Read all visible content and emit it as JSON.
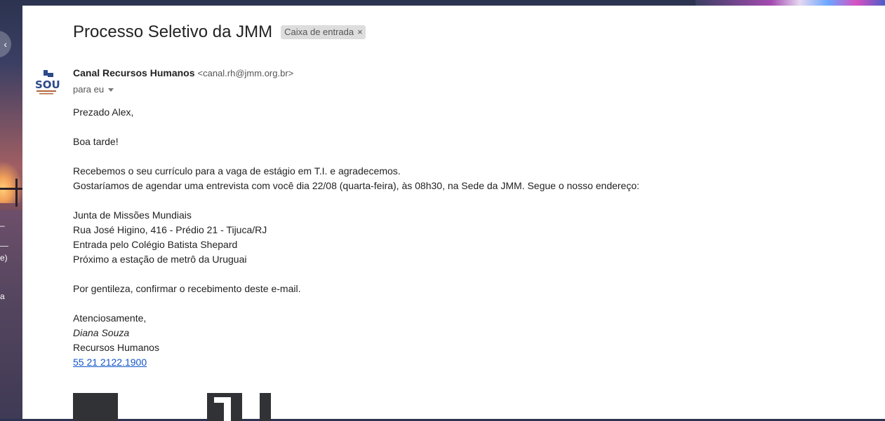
{
  "email": {
    "subject": "Processo Seletivo da JMM",
    "label": "Caixa de entrada",
    "label_close": "×",
    "sender_name": "Canal Recursos Humanos",
    "sender_email": "<canal.rh@jmm.org.br>",
    "to": "para eu",
    "avatar_icon": "sou-logo-icon",
    "body": {
      "greeting": "Prezado Alex,",
      "hello": "Boa tarde!",
      "line1": "Recebemos o seu currículo para a vaga de estágio em T.I. e agradecemos.",
      "line2": "Gostaríamos de agendar uma entrevista com você dia 22/08 (quarta-feira), às 08h30, na Sede da JMM. Segue o nosso endereço:",
      "address": [
        "Junta de Missões Mundiais",
        "Rua José Higino, 416 - Prédio 21 - Tijuca/RJ",
        "Entrada pelo Colégio Batista Shepard",
        "Próximo a estação de metrô da Uruguai"
      ],
      "request": "Por gentileza, confirmar o recebimento deste e-mail.",
      "closing": "Atenciosamente,",
      "signature_name": "Diana Souza",
      "signature_dept": "Recursos Humanos",
      "signature_phone": "55 21 2122.1900"
    }
  },
  "background": {
    "fragments": [
      "–",
      "e)",
      "a"
    ]
  },
  "colors": {
    "link": "#1155cc",
    "chip_bg": "#dddddd"
  }
}
